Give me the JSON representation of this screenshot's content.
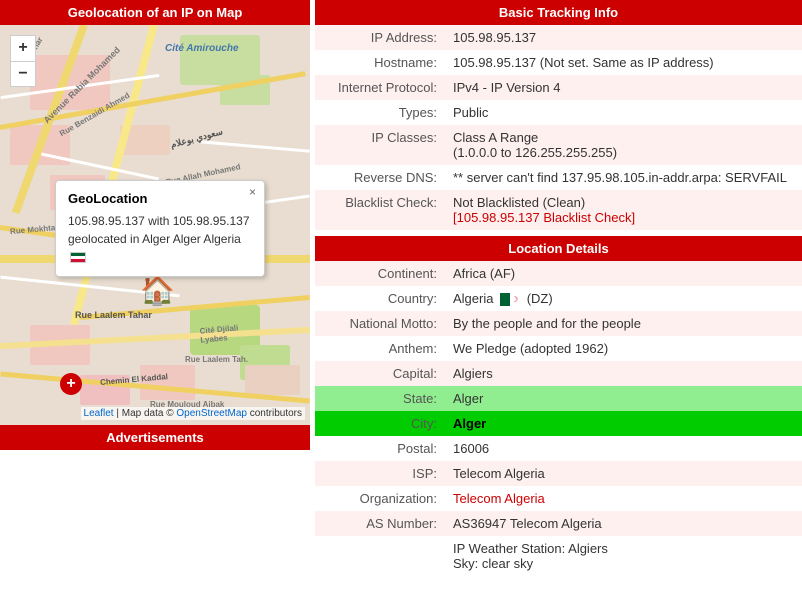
{
  "leftPanel": {
    "mapHeader": "Geolocation of an IP on Map",
    "adsHeader": "Advertisements",
    "zoomIn": "+",
    "zoomOut": "−",
    "popup": {
      "title": "GeoLocation",
      "close": "×",
      "text": "105.98.95.137 with 105.98.95.137 geolocated in Alger Alger Algeria"
    },
    "attribution": "Leaflet | Map data © OpenStreetMap contributors"
  },
  "rightPanel": {
    "basicHeader": "Basic Tracking Info",
    "locationHeader": "Location Details",
    "basic": {
      "ipLabel": "IP Address:",
      "ipValue": "105.98.95.137",
      "hostnameLabel": "Hostname:",
      "hostnameValue": "105.98.95.137 (Not set. Same as IP address)",
      "protocolLabel": "Internet Protocol:",
      "protocolValue": "IPv4 - IP Version 4",
      "typesLabel": "Types:",
      "typesValue": "Public",
      "ipClassesLabel": "IP Classes:",
      "ipClassesValue": "Class A Range",
      "ipClassesValue2": "(1.0.0.0 to 126.255.255.255)",
      "rdnsLabel": "Reverse DNS:",
      "rdnsValue": "** server can't find 137.95.98.105.in-addr.arpa: SERVFAIL",
      "blacklistLabel": "Blacklist Check:",
      "blacklistValue": "Not Blacklisted (Clean)",
      "blacklistLink": "[105.98.95.137 Blacklist Check]"
    },
    "location": {
      "continentLabel": "Continent:",
      "continentValue": "Africa (AF)",
      "countryLabel": "Country:",
      "countryValue": "Algeria",
      "countryCode": "(DZ)",
      "mottoLabel": "National Motto:",
      "mottoValue": "By the people and for the people",
      "anthemLabel": "Anthem:",
      "anthemValue": "We Pledge (adopted 1962)",
      "capitalLabel": "Capital:",
      "capitalValue": "Algiers",
      "stateLabel": "State:",
      "stateValue": "Alger",
      "cityLabel": "City:",
      "cityValue": "Alger",
      "postalLabel": "Postal:",
      "postalValue": "16006",
      "ispLabel": "ISP:",
      "ispValue": "Telecom Algeria",
      "orgLabel": "Organization:",
      "orgValue": "Telecom Algeria",
      "asLabel": "AS Number:",
      "asValue": "AS36947 Telecom Algeria",
      "weatherLabel": "IP Weather Station: Algiers",
      "skyLabel": "Sky: clear sky"
    }
  }
}
